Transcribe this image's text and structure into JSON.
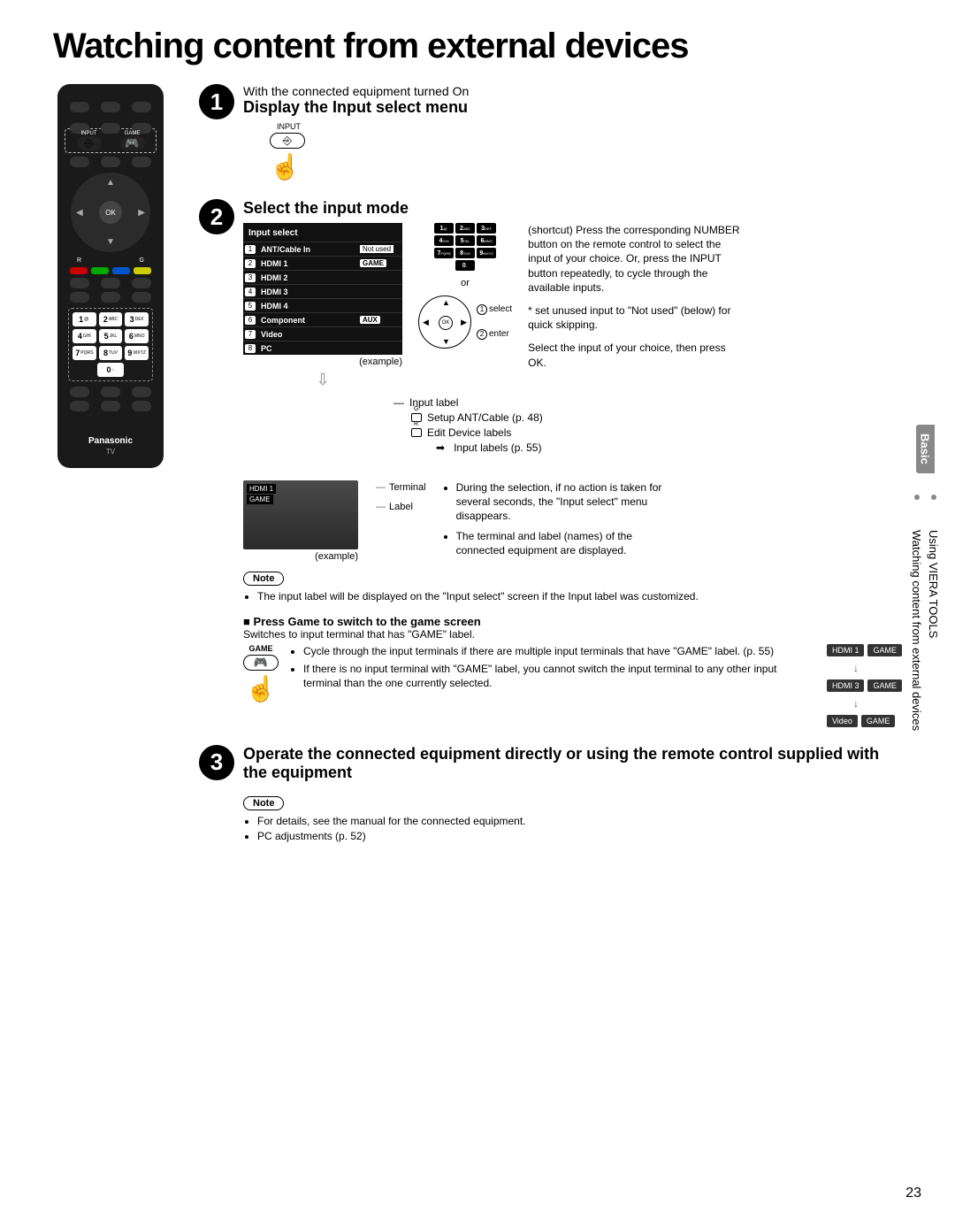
{
  "title": "Watching content from external devices",
  "remote": {
    "input_label": "INPUT",
    "game_label": "GAME",
    "ok": "OK",
    "r": "R",
    "g": "G",
    "keys": [
      {
        "n": "1",
        "s": "@."
      },
      {
        "n": "2",
        "s": "ABC"
      },
      {
        "n": "3",
        "s": "DEF"
      },
      {
        "n": "4",
        "s": "GHI"
      },
      {
        "n": "5",
        "s": "JKL"
      },
      {
        "n": "6",
        "s": "MNO"
      },
      {
        "n": "7",
        "s": "PQRS"
      },
      {
        "n": "8",
        "s": "TUV"
      },
      {
        "n": "9",
        "s": "WXYZ"
      },
      {
        "n": "0",
        "s": "-."
      }
    ],
    "brand": "Panasonic",
    "tv": "TV"
  },
  "step1": {
    "pretext": "With the connected equipment turned On",
    "title": "Display the Input select menu",
    "input_label": "INPUT"
  },
  "step2": {
    "title": "Select the input mode",
    "panel_title": "Input select",
    "items": [
      {
        "n": "1",
        "name": "ANT/Cable In",
        "tag": "Not used",
        "tagstyle": "inv"
      },
      {
        "n": "2",
        "name": "HDMI 1",
        "tag": "GAME",
        "tagstyle": "box"
      },
      {
        "n": "3",
        "name": "HDMI 2",
        "tag": ""
      },
      {
        "n": "4",
        "name": "HDMI 3",
        "tag": ""
      },
      {
        "n": "5",
        "name": "HDMI 4",
        "tag": ""
      },
      {
        "n": "6",
        "name": "Component",
        "tag": "AUX",
        "tagstyle": "box"
      },
      {
        "n": "7",
        "name": "Video",
        "tag": ""
      },
      {
        "n": "8",
        "name": "PC",
        "tag": ""
      }
    ],
    "example": "(example)",
    "or": "or",
    "select": "select",
    "enter": "enter",
    "ok": "OK",
    "shortcut_text": "(shortcut) Press the corresponding NUMBER button on the remote control to select the input of your choice. Or, press the INPUT button repeatedly, to cycle through the available inputs.",
    "star_text": "* set unused input to \"Not used\" (below) for quick skipping.",
    "select_text": "Select the input of your choice, then press OK.",
    "bracket": {
      "input_label": "Input label",
      "setup": "Setup ANT/Cable (p. 48)",
      "edit": "Edit Device labels",
      "labels": "Input labels (p. 55)"
    },
    "terminal": {
      "hdmi": "HDMI 1",
      "game": "GAME",
      "t_terminal": "Terminal",
      "t_label": "Label",
      "example": "(example)",
      "bullets": [
        "During the selection, if no action is taken for several seconds, the \"Input select\" menu disappears.",
        "The terminal and label (names) of the connected equipment are displayed."
      ]
    },
    "note_label": "Note",
    "note_text": "The input label will be displayed on the \"Input select\" screen if the Input label was customized.",
    "game": {
      "heading": "Press Game to switch to the game screen",
      "sub": "Switches to input terminal that has \"GAME\" label.",
      "game_lbl": "GAME",
      "bullets": [
        "Cycle through the input terminals if there are multiple input terminals that have \"GAME\" label. (p. 55)",
        "If there is no input terminal with \"GAME\" label, you cannot switch the input terminal to any other input terminal than the one currently selected."
      ],
      "boxes": [
        {
          "a": "HDMI 1",
          "b": "GAME"
        },
        {
          "a": "HDMI 3",
          "b": "GAME"
        },
        {
          "a": "Video",
          "b": "GAME"
        }
      ]
    }
  },
  "step3": {
    "title": "Operate the connected equipment directly or using the remote control supplied with the equipment",
    "note_label": "Note",
    "bullets": [
      "For details, see the manual for the connected equipment.",
      "PC adjustments (p. 52)"
    ]
  },
  "sidebar": {
    "section": "Basic",
    "crumb1": "Watching content from external devices",
    "crumb2": "Using VIERA TOOLS"
  },
  "page_number": "23"
}
